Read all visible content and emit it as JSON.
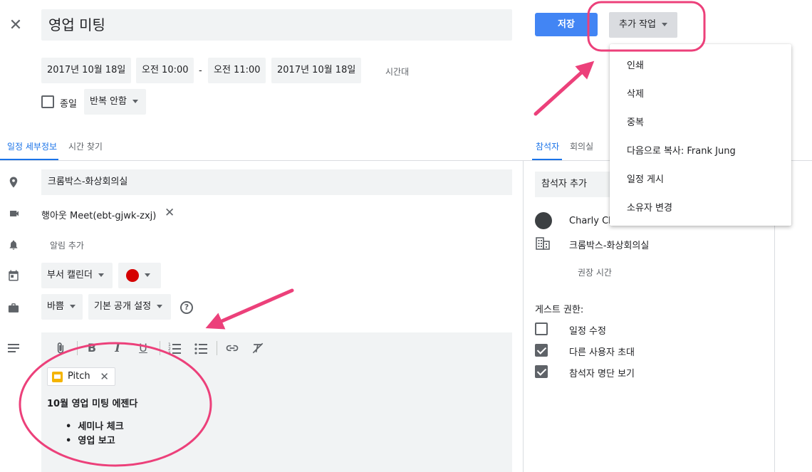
{
  "event": {
    "title": "영업 미팅",
    "start_date": "2017년 10월 18일",
    "start_time": "오전 10:00",
    "dash": "-",
    "end_time": "오전 11:00",
    "end_date": "2017년 10월 18일",
    "timezone_label": "시간대",
    "all_day_label": "종일",
    "repeat_value": "반복 안함"
  },
  "toolbar": {
    "save_label": "저장",
    "more_label": "추가 작업"
  },
  "more_menu": {
    "items": [
      "인쇄",
      "삭제",
      "중복",
      "다음으로 복사: Frank Jung",
      "일정 게시",
      "소유자 변경"
    ]
  },
  "tabs": {
    "details": "일정 세부정보",
    "find_time": "시간 찾기",
    "guests": "참석자",
    "rooms": "회의실"
  },
  "details": {
    "location": "크롬박스-화상회의실",
    "meet_link": "행아웃 Meet(ebt-gjwk-zxj)",
    "add_notification": "알림 추가",
    "calendar": "부서 캘린더",
    "calendar_color": "#d50000",
    "availability": "바쁨",
    "visibility": "기본 공개 설정"
  },
  "description": {
    "attachment_name": "Pitch",
    "heading": "10월 영업 미팅 에젠다",
    "bullets": [
      "세미나 체크",
      "영업 보고"
    ]
  },
  "guests": {
    "add_guests_placeholder": "참석자 추가",
    "list": [
      {
        "name": "Charly Ch"
      },
      {
        "name": "크롬박스-화상회의실"
      }
    ],
    "suggested_times": "권장 시간",
    "permissions_title": "게스트 권한:",
    "permissions": [
      {
        "label": "일정 수정",
        "checked": false
      },
      {
        "label": "다른 사용자 초대",
        "checked": true
      },
      {
        "label": "참석자 명단 보기",
        "checked": true
      }
    ]
  },
  "colors": {
    "accent": "#1a73e8",
    "save_button": "#4285f4",
    "annotation": "#ec407a"
  }
}
